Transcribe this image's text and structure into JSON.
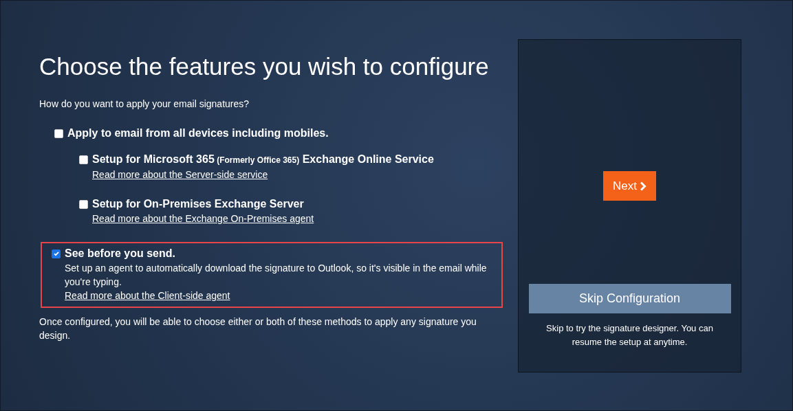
{
  "heading": "Choose the features you wish to configure",
  "question": "How do you want to apply your email signatures?",
  "options": [
    {
      "label": [
        {
          "kind": "main",
          "text": "Apply to email from all devices including mobiles."
        }
      ],
      "checked": false,
      "highlighted": false,
      "children": [
        {
          "label": [
            {
              "kind": "main",
              "text": "Setup for Microsoft 365"
            },
            {
              "kind": "note",
              "text": "(Formerly Office 365)"
            },
            {
              "kind": "main",
              "text": "Exchange Online Service"
            }
          ],
          "checked": false,
          "link": "Read more about the Server-side service"
        },
        {
          "label": [
            {
              "kind": "main",
              "text": "Setup for On-Premises Exchange Server"
            }
          ],
          "checked": false,
          "link": "Read more about the Exchange On-Premises agent"
        }
      ]
    },
    {
      "label": [
        {
          "kind": "main",
          "text": "See before you send."
        }
      ],
      "checked": true,
      "highlighted": true,
      "description": "Set up an agent to automatically download the signature to Outlook, so it's visible in the email while you're typing.",
      "link": "Read more about the Client-side agent"
    }
  ],
  "footnote": "Once configured, you will be able to choose either or both of these methods to apply any signature you design.",
  "side_panel": {
    "next_button": "Next",
    "skip_button": "Skip Configuration",
    "skip_note": "Skip to try the signature designer. You can resume the setup at anytime."
  }
}
